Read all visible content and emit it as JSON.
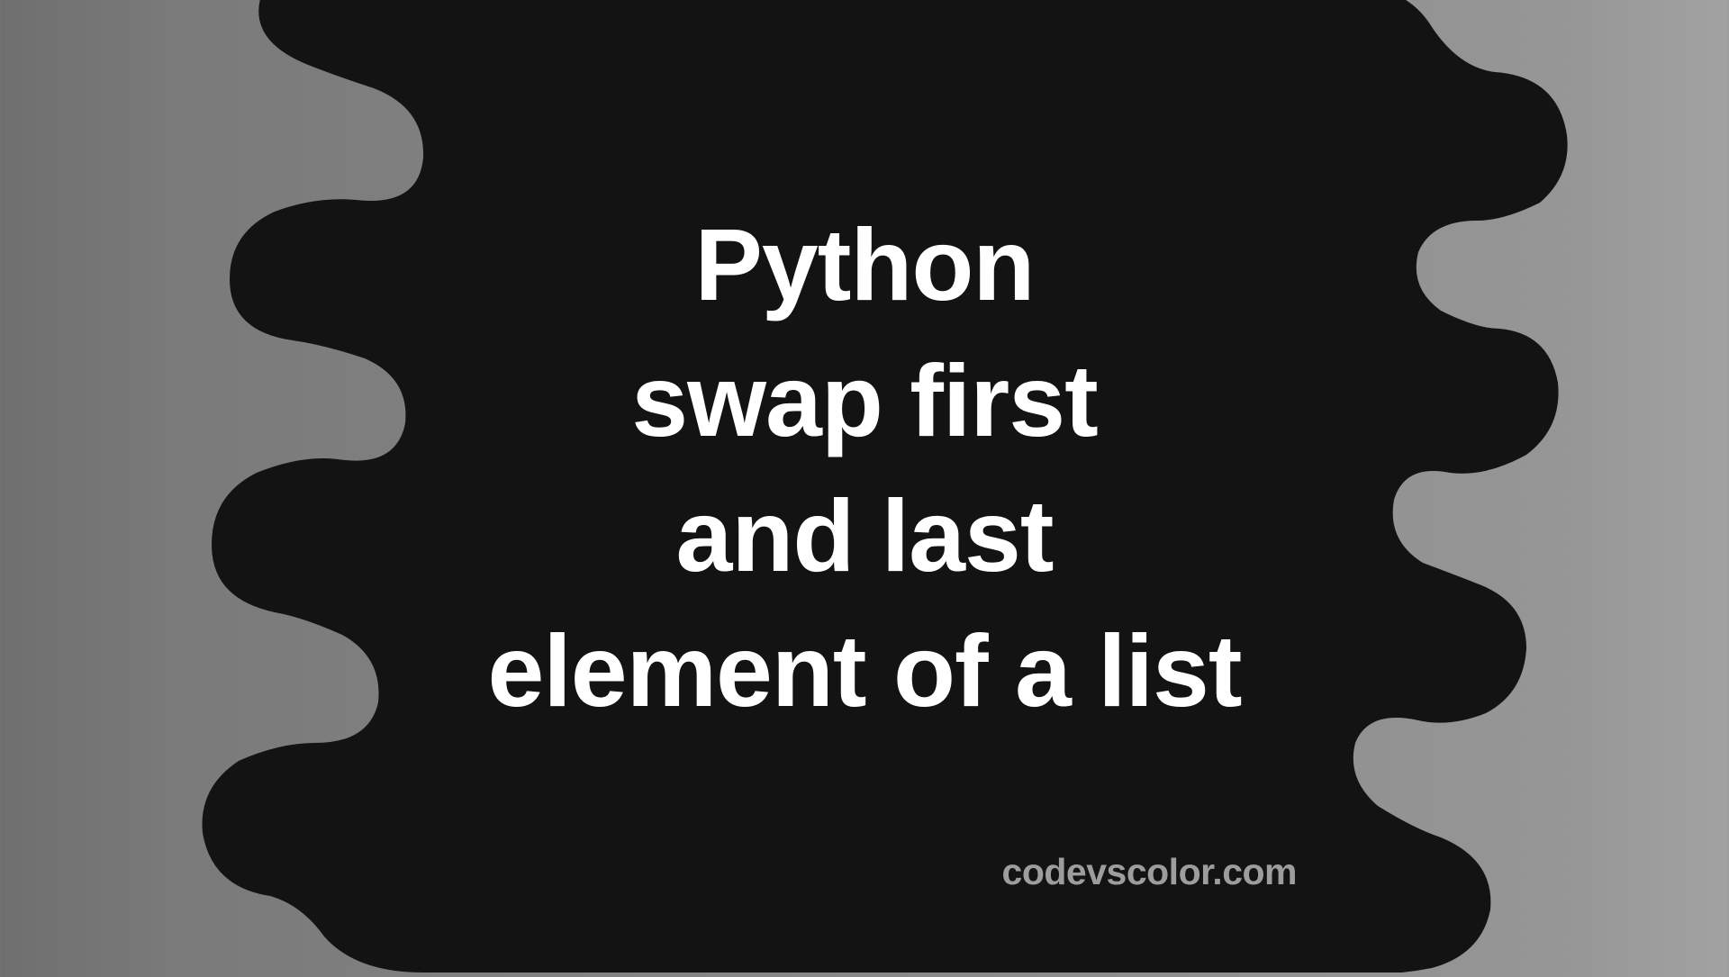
{
  "title": {
    "line1": "Python",
    "line2": "swap first",
    "line3": "and last",
    "line4": "element of a list"
  },
  "watermark": "codevscolor.com"
}
